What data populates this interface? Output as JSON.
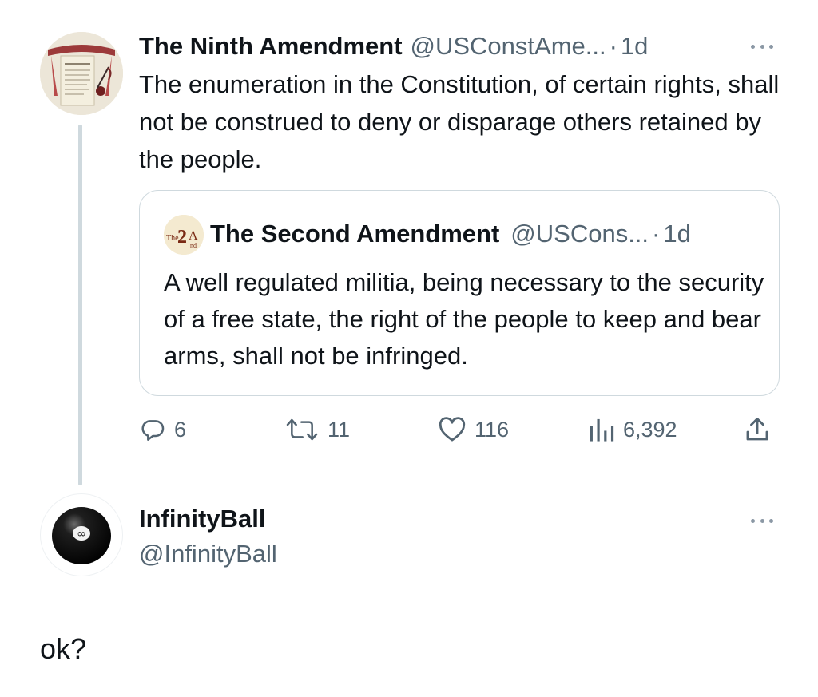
{
  "main_tweet": {
    "author_name": "The Ninth Amendment",
    "handle": "@USConstAme...",
    "separator": "·",
    "time": "1d",
    "text": "The enumeration in the Constitution, of certain rights, shall not be construed to deny or disparage others retained by the people.",
    "quoted_tweet": {
      "author_name": "The Second Amendment",
      "handle": "@USCons...",
      "separator": "·",
      "time": "1d",
      "text": "A well regulated militia, being necessary to the security of a free state, the right of the people to keep and bear arms, shall not be infringed."
    },
    "actions": {
      "replies": "6",
      "reposts": "11",
      "likes": "116",
      "views": "6,392"
    }
  },
  "reply": {
    "author_name": "InfinityBall",
    "handle": "@InfinityBall",
    "text": "ok?"
  },
  "colors": {
    "text_primary": "#0f1419",
    "text_secondary": "#536471",
    "border": "#cfd9de"
  },
  "icons": {
    "reply": "reply-icon",
    "repost": "repost-icon",
    "like": "heart-icon",
    "views": "views-icon",
    "share": "share-icon",
    "more": "more-icon"
  }
}
